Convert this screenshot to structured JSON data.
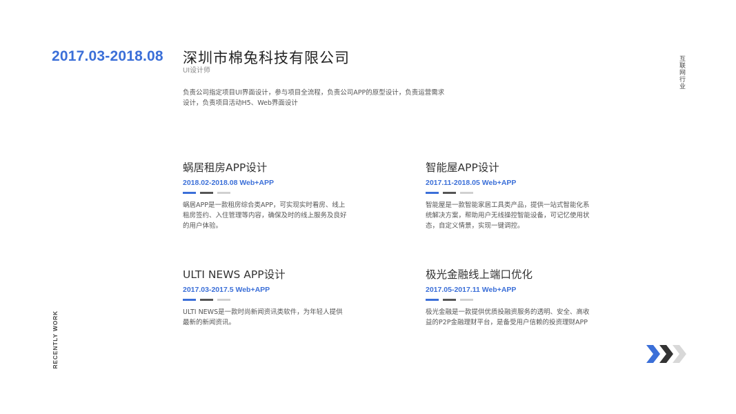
{
  "header": {
    "date_range": "2017.03-2018.08",
    "company": "深圳市棉兔科技有限公司",
    "role": "UI设计师",
    "intro": "负责公司指定项目UI界面设计，参与项目全流程，负责公司APP的原型设计，负责运营需求设计，负责项目活动H5、Web界面设计"
  },
  "side": {
    "industry": "互联网行业",
    "section": "RECENTLY WORK"
  },
  "projects": [
    {
      "title": "蜗居租房APP设计",
      "date": "2018.02-2018.08 Web+APP",
      "desc": "蜗居APP是一款租房综合类APP，可实现实时看房、线上租房签约、入住管理等内容，确保及时的线上服务及良好的用户体验。"
    },
    {
      "title": "智能屋APP设计",
      "date": "2017.11-2018.05 Web+APP",
      "desc": "智能屋是一款智能家居工具类产品，提供一站式智能化系统解决方案，帮助用户无线操控智能设备，可记忆使用状态，自定义情景，实现一键调控。"
    },
    {
      "title": "ULTI NEWS APP设计",
      "date": "2017.03-2017.5 Web+APP",
      "desc": "ULTI NEWS是一款时尚新闻资讯类软件，为年轻人提供最新的新闻资讯。"
    },
    {
      "title": "极光金融线上端口优化",
      "date": "2017.05-2017.11 Web+APP",
      "desc": "极光金融是一款提供优质投融资服务的透明、安全、高收益的P2P金融理财平台，是备受用户信赖的投资理财APP"
    }
  ],
  "colors": {
    "accent": "#3b6fd8",
    "dark": "#333333",
    "light": "#d0d0d0"
  },
  "icons": {
    "next": "chevron-right-triple-icon"
  }
}
